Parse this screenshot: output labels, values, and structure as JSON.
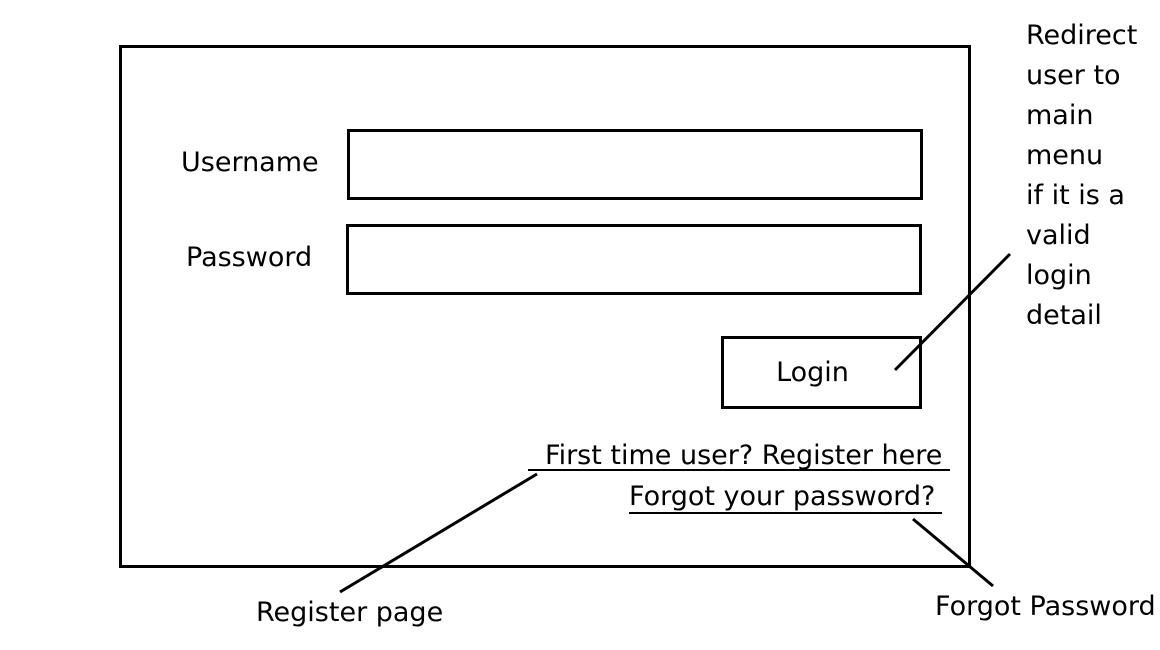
{
  "form": {
    "username_label": "Username",
    "username_value": "",
    "password_label": "Password",
    "password_value": "",
    "login_label": "Login",
    "register_link": "First time user? Register here",
    "forgot_link": "Forgot your password?"
  },
  "annotations": {
    "login_note_lines": [
      "Redirect",
      "user to",
      "main",
      "menu",
      "if it is a",
      "valid",
      "login",
      "detail"
    ],
    "register_note": "Register page",
    "forgot_note": "Forgot Password"
  },
  "colors": {
    "stroke": "#000000",
    "background": "#ffffff"
  }
}
